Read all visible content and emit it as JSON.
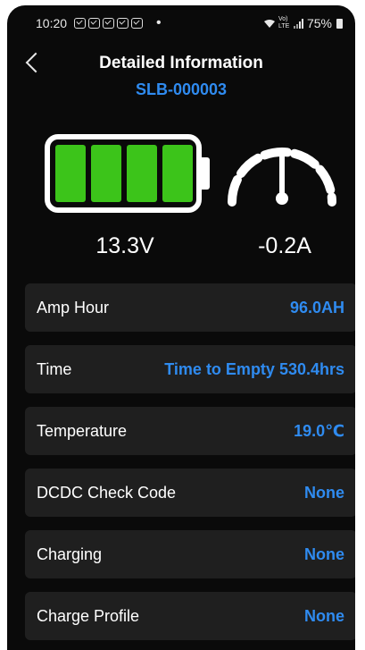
{
  "status_bar": {
    "time": "10:20",
    "network": "Vo) LTE",
    "battery": "75%"
  },
  "header": {
    "title": "Detailed Information",
    "device_id": "SLB-000003"
  },
  "readings": {
    "voltage": "13.3V",
    "current": "-0.2A",
    "battery_cells_filled": 4
  },
  "details": [
    {
      "label": "Amp Hour",
      "value": "96.0AH"
    },
    {
      "label": "Time",
      "value": "Time to Empty 530.4hrs"
    },
    {
      "label": "Temperature",
      "value": "19.0℃"
    },
    {
      "label": "DCDC Check Code",
      "value": "None"
    },
    {
      "label": "Charging",
      "value": "None"
    },
    {
      "label": "Charge Profile",
      "value": "None"
    }
  ],
  "colors": {
    "accent": "#2f8bf0",
    "battery_fill": "#3cc41a",
    "background": "#0a0a0a",
    "row_background": "#1f1f1f"
  },
  "icons": {
    "battery": "battery-icon",
    "current": "speedometer-icon",
    "back": "back-chevron-icon"
  }
}
